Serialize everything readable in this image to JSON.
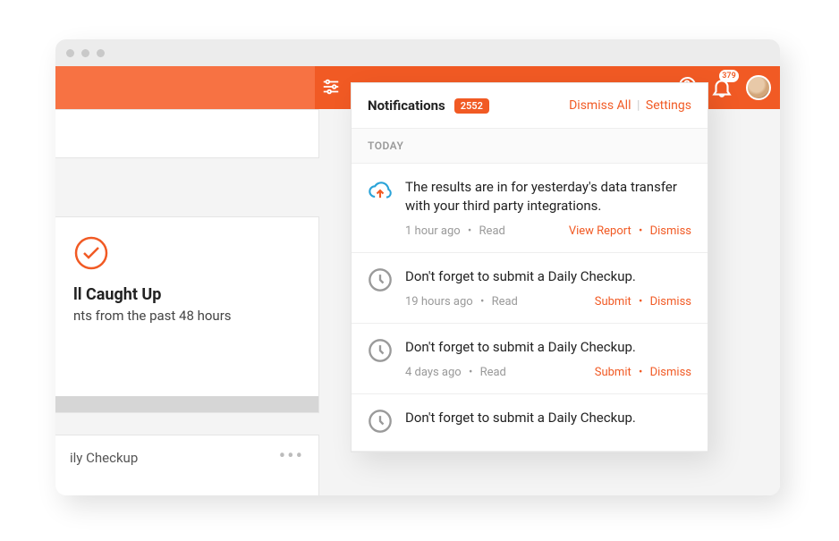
{
  "header": {
    "notification_count": "379"
  },
  "background": {
    "caught_up_title": "ll Caught Up",
    "caught_up_subtitle": "nts from the past 48 hours",
    "daily_checkup_label": "ily Checkup"
  },
  "panel": {
    "title": "Notifications",
    "count": "2552",
    "dismiss_all": "Dismiss All",
    "settings": "Settings",
    "group_today": "TODAY",
    "items": [
      {
        "icon": "cloud-upload",
        "text": "The results are in for yesterday's data transfer with your third party integrations.",
        "time": "1 hour ago",
        "read": "Read",
        "action1": "View Report",
        "action2": "Dismiss"
      },
      {
        "icon": "clock",
        "text": "Don't forget to submit a Daily Checkup.",
        "time": "19 hours ago",
        "read": "Read",
        "action1": "Submit",
        "action2": "Dismiss"
      },
      {
        "icon": "clock",
        "text": "Don't forget to submit a Daily Checkup.",
        "time": "4 days ago",
        "read": "Read",
        "action1": "Submit",
        "action2": "Dismiss"
      },
      {
        "icon": "clock",
        "text": "Don't forget to submit a Daily Checkup.",
        "time": "",
        "read": "",
        "action1": "",
        "action2": ""
      }
    ]
  }
}
